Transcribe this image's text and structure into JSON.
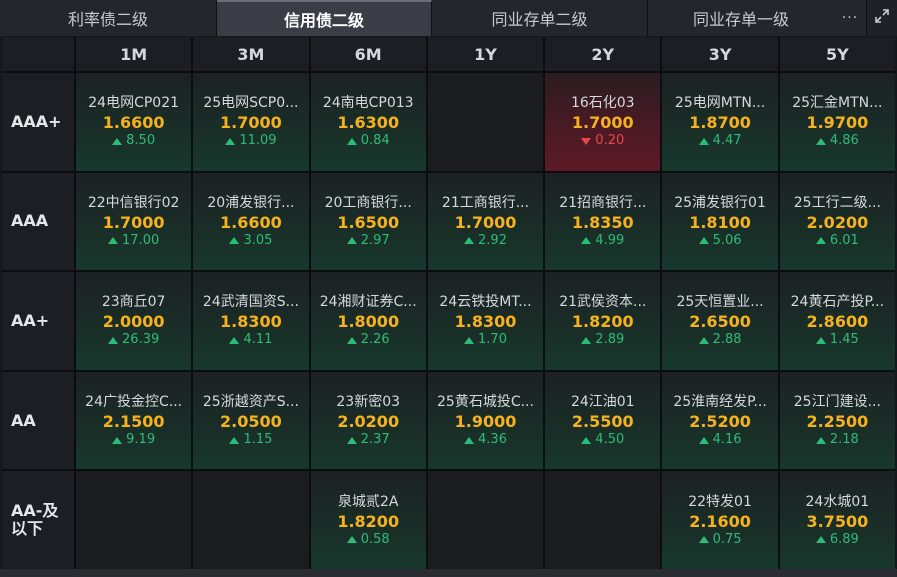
{
  "tabs": [
    {
      "label": "利率债二级",
      "active": false
    },
    {
      "label": "信用债二级",
      "active": true
    },
    {
      "label": "同业存单二级",
      "active": false
    },
    {
      "label": "同业存单一级",
      "active": false
    }
  ],
  "toolbar": {
    "more_label": "···"
  },
  "columns": [
    "1M",
    "3M",
    "6M",
    "1Y",
    "2Y",
    "3Y",
    "5Y"
  ],
  "colors": {
    "yield": "#f5b21c",
    "up": "#2bbd78",
    "down": "#e5484d"
  },
  "rows": [
    {
      "rating": "AAA+",
      "cells": [
        {
          "name": "24电网CP021",
          "yield": "1.6600",
          "dir": "up",
          "change": "8.50"
        },
        {
          "name": "25电网SCP0...",
          "yield": "1.7000",
          "dir": "up",
          "change": "11.09"
        },
        {
          "name": "24南电CP013",
          "yield": "1.6300",
          "dir": "up",
          "change": "0.84"
        },
        null,
        {
          "name": "16石化03",
          "yield": "1.7000",
          "dir": "down",
          "change": "0.20"
        },
        {
          "name": "25电网MTN...",
          "yield": "1.8700",
          "dir": "up",
          "change": "4.47"
        },
        {
          "name": "25汇金MTN...",
          "yield": "1.9700",
          "dir": "up",
          "change": "4.86"
        }
      ]
    },
    {
      "rating": "AAA",
      "cells": [
        {
          "name": "22中信银行02",
          "yield": "1.7000",
          "dir": "up",
          "change": "17.00"
        },
        {
          "name": "20浦发银行...",
          "yield": "1.6600",
          "dir": "up",
          "change": "3.05"
        },
        {
          "name": "20工商银行...",
          "yield": "1.6500",
          "dir": "up",
          "change": "2.97"
        },
        {
          "name": "21工商银行...",
          "yield": "1.7000",
          "dir": "up",
          "change": "2.92"
        },
        {
          "name": "21招商银行...",
          "yield": "1.8350",
          "dir": "up",
          "change": "4.99"
        },
        {
          "name": "25浦发银行01",
          "yield": "1.8100",
          "dir": "up",
          "change": "5.06"
        },
        {
          "name": "25工行二级...",
          "yield": "2.0200",
          "dir": "up",
          "change": "6.01"
        }
      ]
    },
    {
      "rating": "AA+",
      "cells": [
        {
          "name": "23商丘07",
          "yield": "2.0000",
          "dir": "up",
          "change": "26.39"
        },
        {
          "name": "24武清国资S...",
          "yield": "1.8300",
          "dir": "up",
          "change": "4.11"
        },
        {
          "name": "24湘财证券C...",
          "yield": "1.8000",
          "dir": "up",
          "change": "2.26"
        },
        {
          "name": "24云铁投MT...",
          "yield": "1.8300",
          "dir": "up",
          "change": "1.70"
        },
        {
          "name": "21武侯资本...",
          "yield": "1.8200",
          "dir": "up",
          "change": "2.89"
        },
        {
          "name": "25天恒置业...",
          "yield": "2.6500",
          "dir": "up",
          "change": "2.88"
        },
        {
          "name": "24黄石产投P...",
          "yield": "2.8600",
          "dir": "up",
          "change": "1.45"
        }
      ]
    },
    {
      "rating": "AA",
      "cells": [
        {
          "name": "24广投金控C...",
          "yield": "2.1500",
          "dir": "up",
          "change": "9.19"
        },
        {
          "name": "25浙越资产S...",
          "yield": "2.0500",
          "dir": "up",
          "change": "1.15"
        },
        {
          "name": "23新密03",
          "yield": "2.0200",
          "dir": "up",
          "change": "2.37"
        },
        {
          "name": "25黄石城投C...",
          "yield": "1.9000",
          "dir": "up",
          "change": "4.36"
        },
        {
          "name": "24江油01",
          "yield": "2.5500",
          "dir": "up",
          "change": "4.50"
        },
        {
          "name": "25淮南经发P...",
          "yield": "2.5200",
          "dir": "up",
          "change": "4.16"
        },
        {
          "name": "25江门建设...",
          "yield": "2.2500",
          "dir": "up",
          "change": "2.18"
        }
      ]
    },
    {
      "rating": "AA-及\n以下",
      "cells": [
        null,
        null,
        {
          "name": "泉城贰2A",
          "yield": "1.8200",
          "dir": "up",
          "change": "0.58"
        },
        null,
        null,
        {
          "name": "22特发01",
          "yield": "2.1600",
          "dir": "up",
          "change": "0.75"
        },
        {
          "name": "24水城01",
          "yield": "3.7500",
          "dir": "up",
          "change": "6.89"
        }
      ]
    }
  ]
}
